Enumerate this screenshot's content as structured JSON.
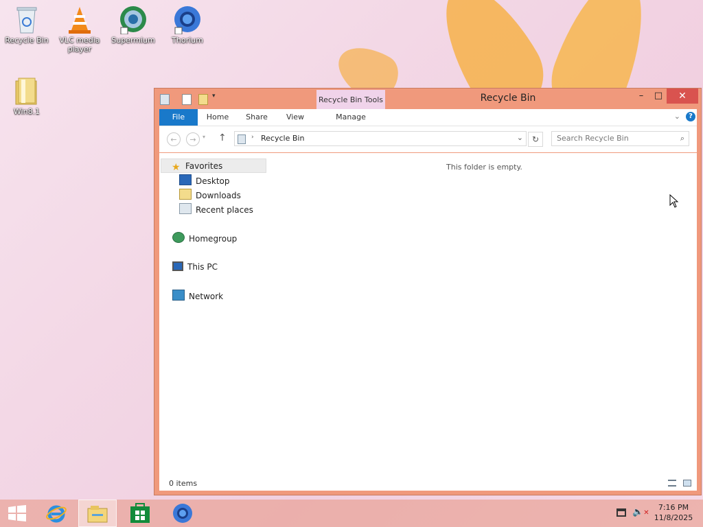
{
  "desktop": {
    "icons": [
      {
        "label": "Recycle Bin",
        "icon": "recycle-bin-icon"
      },
      {
        "label": "VLC media player",
        "icon": "vlc-icon"
      },
      {
        "label": "Supermium",
        "icon": "supermium-icon"
      },
      {
        "label": "Thorium",
        "icon": "thorium-icon"
      },
      {
        "label": "Win8.1",
        "icon": "folder-icon"
      }
    ]
  },
  "window": {
    "title": "Recycle Bin",
    "contextual_tab_group": "Recycle Bin Tools",
    "ribbon_tabs": [
      "File",
      "Home",
      "Share",
      "View",
      "Manage"
    ],
    "address": {
      "path": "Recycle Bin"
    },
    "search": {
      "placeholder": "Search Recycle Bin"
    },
    "nav_pane": {
      "favorites": "Favorites",
      "favorites_items": [
        "Desktop",
        "Downloads",
        "Recent places"
      ],
      "homegroup": "Homegroup",
      "this_pc": "This PC",
      "network": "Network"
    },
    "empty_message": "This folder is empty.",
    "status": {
      "items": "0 items"
    }
  },
  "taskbar": {
    "clock": {
      "time": "7:16 PM",
      "date": "11/8/2025"
    }
  },
  "colors": {
    "window_frame": "#f0997c",
    "file_tab": "#1979ca",
    "close_button": "#d9534f",
    "context_tab": "#f0d3ea"
  }
}
